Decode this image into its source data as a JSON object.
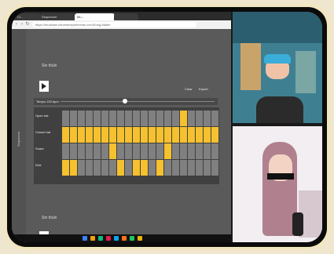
{
  "browser": {
    "tabs": [
      {
        "label": "Cl...",
        "active": false
      },
      {
        "label": "Sequencer",
        "active": false
      },
      {
        "label": "Mu...",
        "active": true
      },
      {
        "label": "",
        "active": false
      }
    ],
    "url": "https://musiclab.chromeexperiments.com/Song-Maker",
    "nav_icons": [
      "back-icon",
      "forward-icon",
      "refresh-icon"
    ]
  },
  "page": {
    "sidebar_text": "Sequencer",
    "section1_title": "Sin título",
    "section1_links": [
      "Clear",
      "Export"
    ],
    "tempo_label": "Tempo 120 bpm",
    "tempo_level": 0.42,
    "rows": [
      {
        "label": "Open hat",
        "cells": [
          0,
          0,
          0,
          0,
          0,
          0,
          0,
          0,
          0,
          0,
          0,
          0,
          0,
          0,
          0,
          1,
          0,
          0,
          0,
          0
        ]
      },
      {
        "label": "Closed hat",
        "cells": [
          1,
          1,
          1,
          1,
          1,
          1,
          1,
          1,
          1,
          1,
          1,
          1,
          1,
          1,
          1,
          1,
          1,
          1,
          1,
          1
        ]
      },
      {
        "label": "Snare",
        "cells": [
          0,
          0,
          0,
          0,
          0,
          0,
          1,
          0,
          0,
          0,
          0,
          0,
          0,
          1,
          0,
          0,
          0,
          0,
          0,
          0
        ]
      },
      {
        "label": "Kick",
        "cells": [
          1,
          1,
          0,
          0,
          0,
          0,
          0,
          1,
          0,
          1,
          1,
          0,
          1,
          0,
          0,
          0,
          0,
          0,
          0,
          0
        ]
      }
    ],
    "section2_title": "Sin título",
    "section2_links": [
      "Clear",
      "Export"
    ]
  },
  "taskbar": {
    "icon_colors": [
      "#3b82f6",
      "#f59e0b",
      "#10b981",
      "#e11d48",
      "#0ea5e9",
      "#f97316",
      "#22c55e",
      "#eab308"
    ]
  },
  "colors": {
    "grid_active": "#f6c12f",
    "grid_inactive": "#808080",
    "frame_glow": "#f4e7b8"
  }
}
